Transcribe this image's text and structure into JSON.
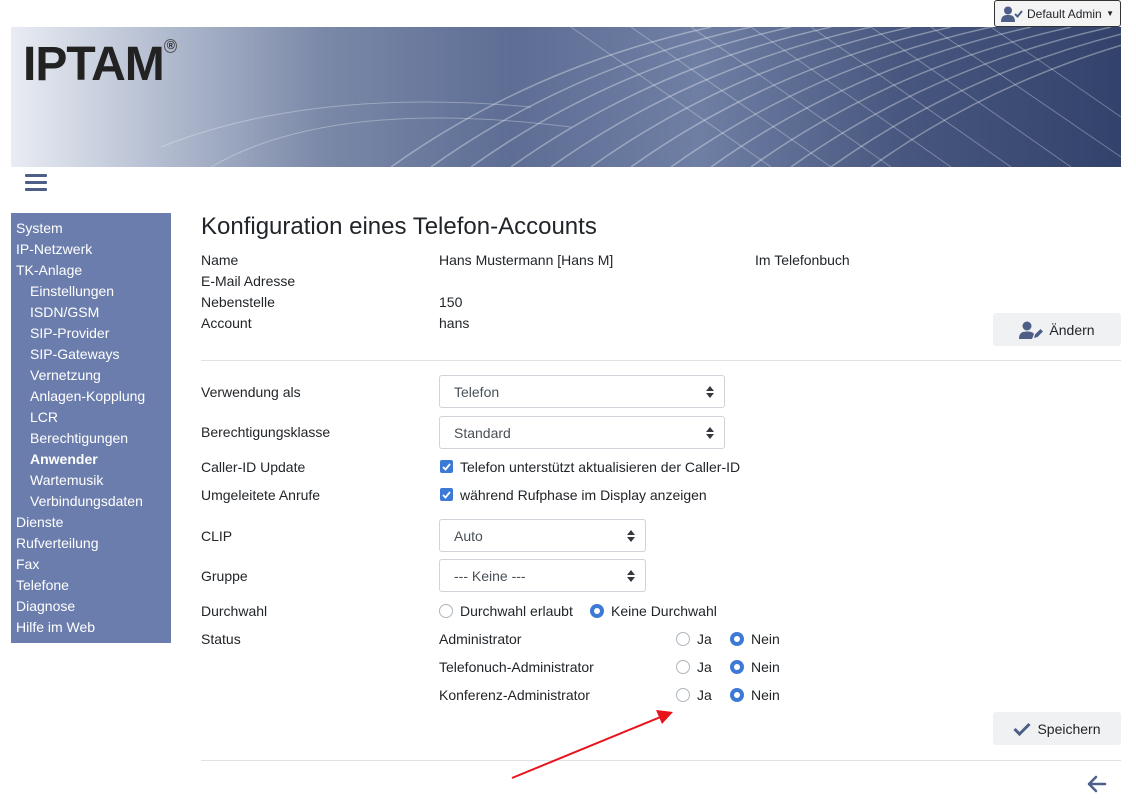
{
  "header": {
    "user_button": "Default Admin",
    "logo_text": "IPTAM",
    "logo_mark": "®"
  },
  "sidebar": {
    "items": [
      {
        "label": "System"
      },
      {
        "label": "IP-Netzwerk"
      },
      {
        "label": "TK-Anlage"
      },
      {
        "label": "Einstellungen"
      },
      {
        "label": "ISDN/GSM"
      },
      {
        "label": "SIP-Provider"
      },
      {
        "label": "SIP-Gateways"
      },
      {
        "label": "Vernetzung"
      },
      {
        "label": "Anlagen-Kopplung"
      },
      {
        "label": "LCR"
      },
      {
        "label": "Berechtigungen"
      },
      {
        "label": "Anwender"
      },
      {
        "label": "Wartemusik"
      },
      {
        "label": "Verbindungsdaten"
      },
      {
        "label": "Dienste"
      },
      {
        "label": "Rufverteilung"
      },
      {
        "label": "Fax"
      },
      {
        "label": "Telefone"
      },
      {
        "label": "Diagnose"
      },
      {
        "label": "Hilfe im Web"
      }
    ]
  },
  "main": {
    "title": "Konfiguration eines Telefon-Accounts",
    "info": {
      "name_label": "Name",
      "name_value": "Hans Mustermann [Hans M]",
      "phonebook_label": "Im Telefonbuch",
      "email_label": "E-Mail Adresse",
      "extension_label": "Nebenstelle",
      "extension_value": "150",
      "account_label": "Account",
      "account_value": "hans"
    },
    "change_button": "Ändern",
    "form": {
      "usage_label": "Verwendung als",
      "usage_value": "Telefon",
      "class_label": "Berechtigungsklasse",
      "class_value": "Standard",
      "callerid_label": "Caller-ID Update",
      "callerid_text": "Telefon unterstützt aktualisieren der Caller-ID",
      "callerid_checked": true,
      "redirect_label": "Umgeleitete Anrufe",
      "redirect_text": "während Rufphase im Display anzeigen",
      "redirect_checked": true,
      "clip_label": "CLIP",
      "clip_value": "Auto",
      "group_label": "Gruppe",
      "group_value": "--- Keine ---",
      "ddi_label": "Durchwahl",
      "ddi_option_allowed": "Durchwahl erlaubt",
      "ddi_option_none": "Keine Durchwahl",
      "ddi_selected": "none",
      "status_label": "Status",
      "status_rows": [
        {
          "label": "Administrator",
          "yes": "Ja",
          "no": "Nein",
          "selected": "no"
        },
        {
          "label": "Telefonuch-Administrator",
          "yes": "Ja",
          "no": "Nein",
          "selected": "no"
        },
        {
          "label": "Konferenz-Administrator",
          "yes": "Ja",
          "no": "Nein",
          "selected": "no"
        }
      ]
    },
    "save_button": "Speichern"
  },
  "colors": {
    "sidebar_bg": "#6b7dac",
    "accent": "#3d7ad6",
    "annotation_arrow": "#e8141b"
  },
  "icons": [
    "user-check-icon",
    "caret-down-icon",
    "hamburger-menu-icon",
    "user-edit-icon",
    "check-icon",
    "arrow-left-icon"
  ]
}
